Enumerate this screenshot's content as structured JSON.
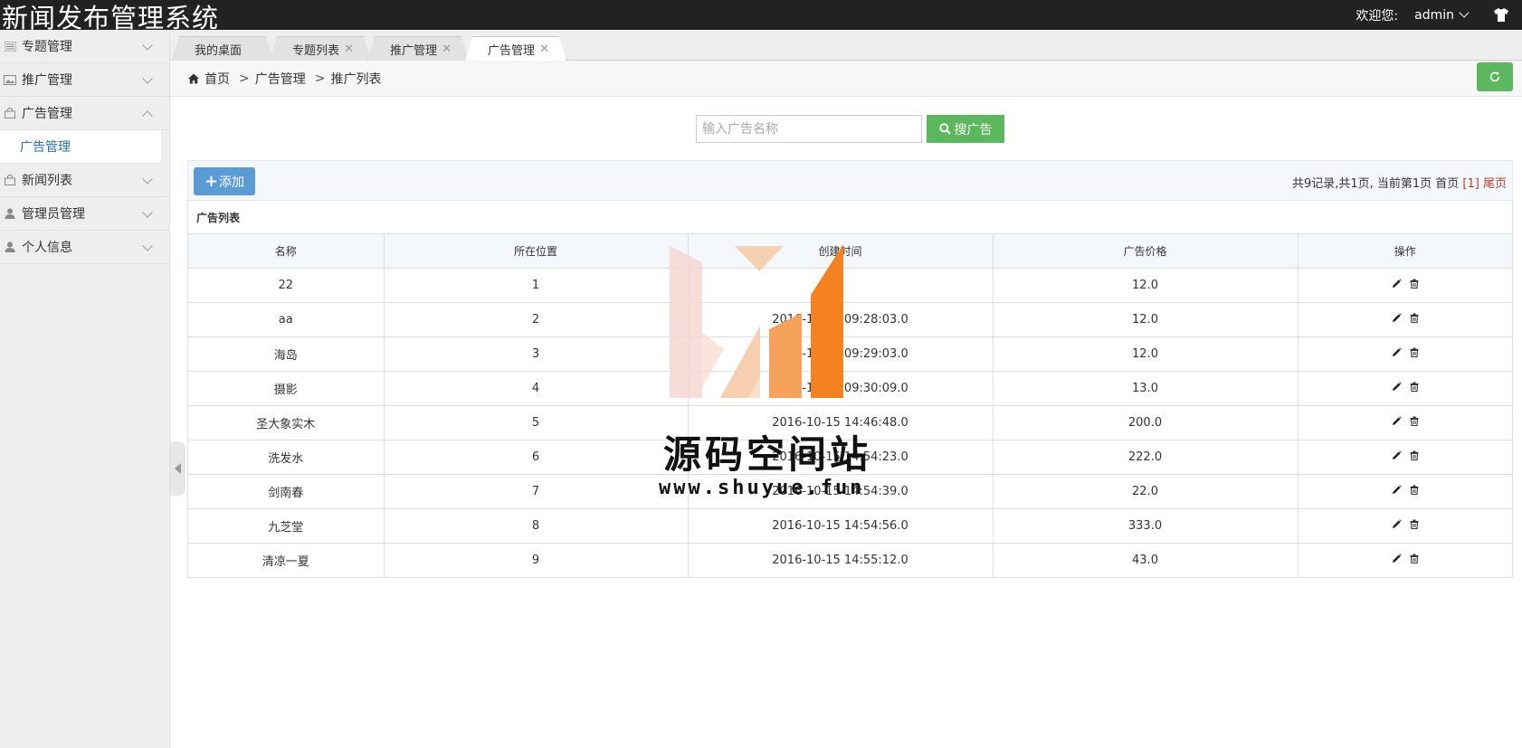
{
  "app": {
    "title": "新闻发布管理系统"
  },
  "header": {
    "welcome": "欢迎您:",
    "username": "admin"
  },
  "sidebar": {
    "items": [
      {
        "label": "专题管理",
        "expanded": false
      },
      {
        "label": "推广管理",
        "expanded": false
      },
      {
        "label": "广告管理",
        "expanded": true
      },
      {
        "label": "新闻列表",
        "expanded": false
      },
      {
        "label": "管理员管理",
        "expanded": false
      },
      {
        "label": "个人信息",
        "expanded": false
      }
    ],
    "active_sub": "广告管理"
  },
  "tabs": [
    "我的桌面",
    "专题列表",
    "推广管理",
    "广告管理"
  ],
  "breadcrumb": {
    "home": "首页",
    "level1": "广告管理",
    "level2": "推广列表",
    "sep": ">"
  },
  "search": {
    "placeholder": "输入广告名称",
    "button": "搜广告"
  },
  "toolbar": {
    "add": "添加",
    "pager_prefix": "共9记录,共1页, 当前第1页 首页 ",
    "pager_current": "[1]",
    "pager_last": "尾页"
  },
  "table": {
    "caption": "广告列表",
    "columns": [
      "名称",
      "所在位置",
      "创建时间",
      "广告价格",
      "操作"
    ],
    "rows": [
      {
        "name": "22",
        "position": "1",
        "time": "",
        "price": "12.0"
      },
      {
        "name": "aa",
        "position": "2",
        "time": "2016-10-15 09:28:03.0",
        "price": "12.0"
      },
      {
        "name": "海岛",
        "position": "3",
        "time": "2016-10-15 09:29:03.0",
        "price": "12.0"
      },
      {
        "name": "摄影",
        "position": "4",
        "time": "2016-10-15 09:30:09.0",
        "price": "13.0"
      },
      {
        "name": "圣大象实木",
        "position": "5",
        "time": "2016-10-15 14:46:48.0",
        "price": "200.0"
      },
      {
        "name": "洗发水",
        "position": "6",
        "time": "2016-10-15 14:54:23.0",
        "price": "222.0"
      },
      {
        "name": "剑南春",
        "position": "7",
        "time": "2016-10-15 14:54:39.0",
        "price": "22.0"
      },
      {
        "name": "九芝堂",
        "position": "8",
        "time": "2016-10-15 14:54:56.0",
        "price": "333.0"
      },
      {
        "name": "清凉一夏",
        "position": "9",
        "time": "2016-10-15 14:55:12.0",
        "price": "43.0"
      }
    ]
  },
  "watermark": {
    "title": "源码空间站",
    "url": "www.shuyue.fun"
  },
  "colors": {
    "topbar": "#222222",
    "green": "#5cb85c",
    "blue": "#5a9bd5",
    "link": "#2a6fa8",
    "pager_red": "#c0392b"
  },
  "icons": {
    "sidebar": [
      "list-icon",
      "image-icon",
      "bag-icon",
      "bag-icon",
      "user-icon",
      "user-icon"
    ],
    "actions": [
      "edit-icon",
      "trash-icon"
    ]
  }
}
